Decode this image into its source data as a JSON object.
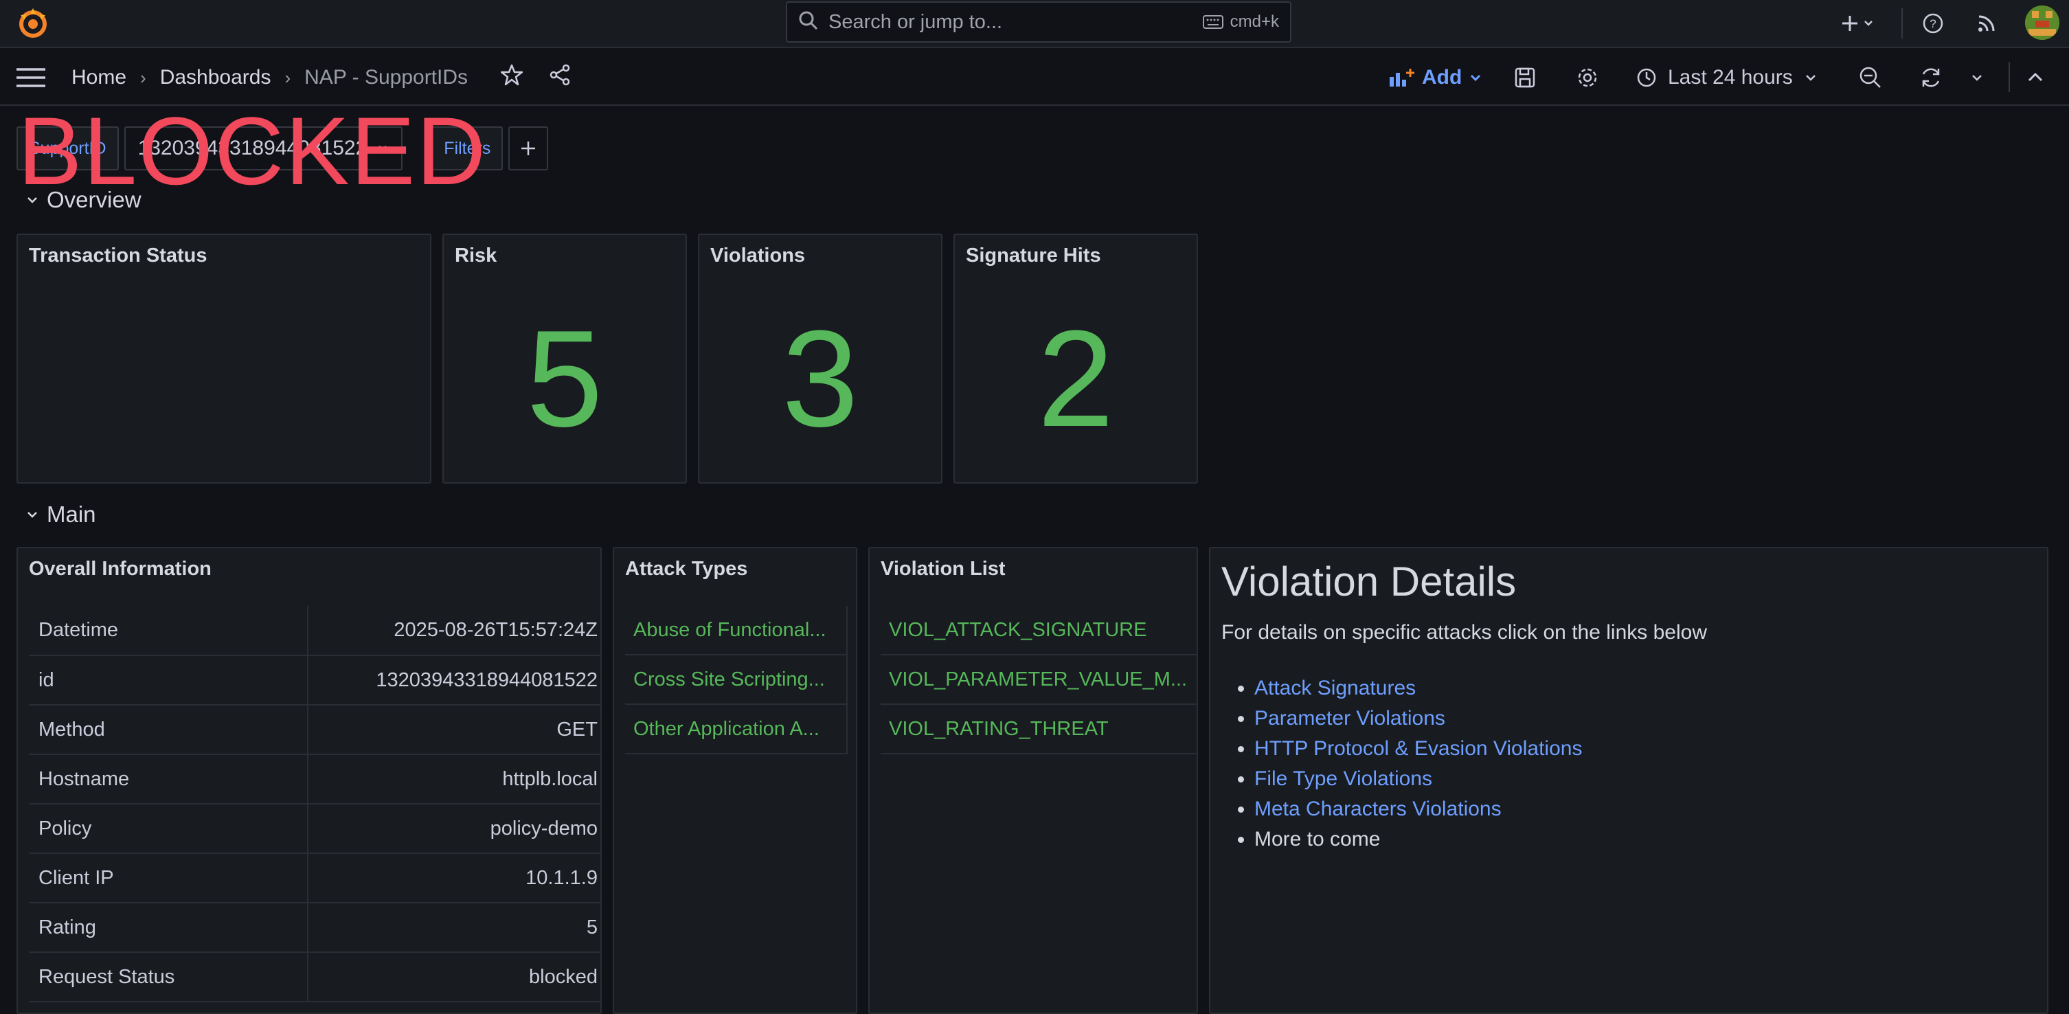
{
  "topbar": {
    "search_placeholder": "Search or jump to...",
    "search_shortcut": "cmd+k"
  },
  "breadcrumb": [
    "Home",
    "Dashboards",
    "NAP - SupportIDs"
  ],
  "toolbar": {
    "add_label": "Add",
    "time_range": "Last 24 hours"
  },
  "variables": {
    "supportid_label": "SupportID",
    "supportid_value": "13203943318944081522",
    "filters_label": "Filters"
  },
  "rows": {
    "overview": "Overview",
    "main": "Main"
  },
  "stats": {
    "transaction_status": {
      "title": "Transaction Status",
      "value": "BLOCKED",
      "color": "#f2495c"
    },
    "risk": {
      "title": "Risk",
      "value": "5"
    },
    "violations": {
      "title": "Violations",
      "value": "3"
    },
    "signature_hits": {
      "title": "Signature Hits",
      "value": "2"
    },
    "value_color": "#56b85a"
  },
  "overall_info": {
    "title": "Overall Information",
    "rows": [
      {
        "key": "Datetime",
        "value": "2025-08-26T15:57:24Z"
      },
      {
        "key": "id",
        "value": "13203943318944081522"
      },
      {
        "key": "Method",
        "value": "GET"
      },
      {
        "key": "Hostname",
        "value": "httplb.local"
      },
      {
        "key": "Policy",
        "value": "policy-demo"
      },
      {
        "key": "Client IP",
        "value": "10.1.1.9"
      },
      {
        "key": "Rating",
        "value": "5"
      },
      {
        "key": "Request Status",
        "value": "blocked"
      }
    ]
  },
  "attack_types": {
    "title": "Attack Types",
    "items": [
      "Abuse of Functional...",
      "Cross Site Scripting...",
      "Other Application A..."
    ]
  },
  "violation_list": {
    "title": "Violation List",
    "items": [
      "VIOL_ATTACK_SIGNATURE",
      "VIOL_PARAMETER_VALUE_M...",
      "VIOL_RATING_THREAT"
    ]
  },
  "violation_details": {
    "title": "Violation Details",
    "intro": "For details on specific attacks click on the links below",
    "links": [
      "Attack Signatures",
      "Parameter Violations",
      "HTTP Protocol & Evasion Violations",
      "File Type Violations",
      "Meta Characters Violations"
    ],
    "more": "More to come"
  },
  "colors": {
    "accent": "#6e9fff",
    "ok": "#56b85a",
    "bad": "#f2495c"
  }
}
